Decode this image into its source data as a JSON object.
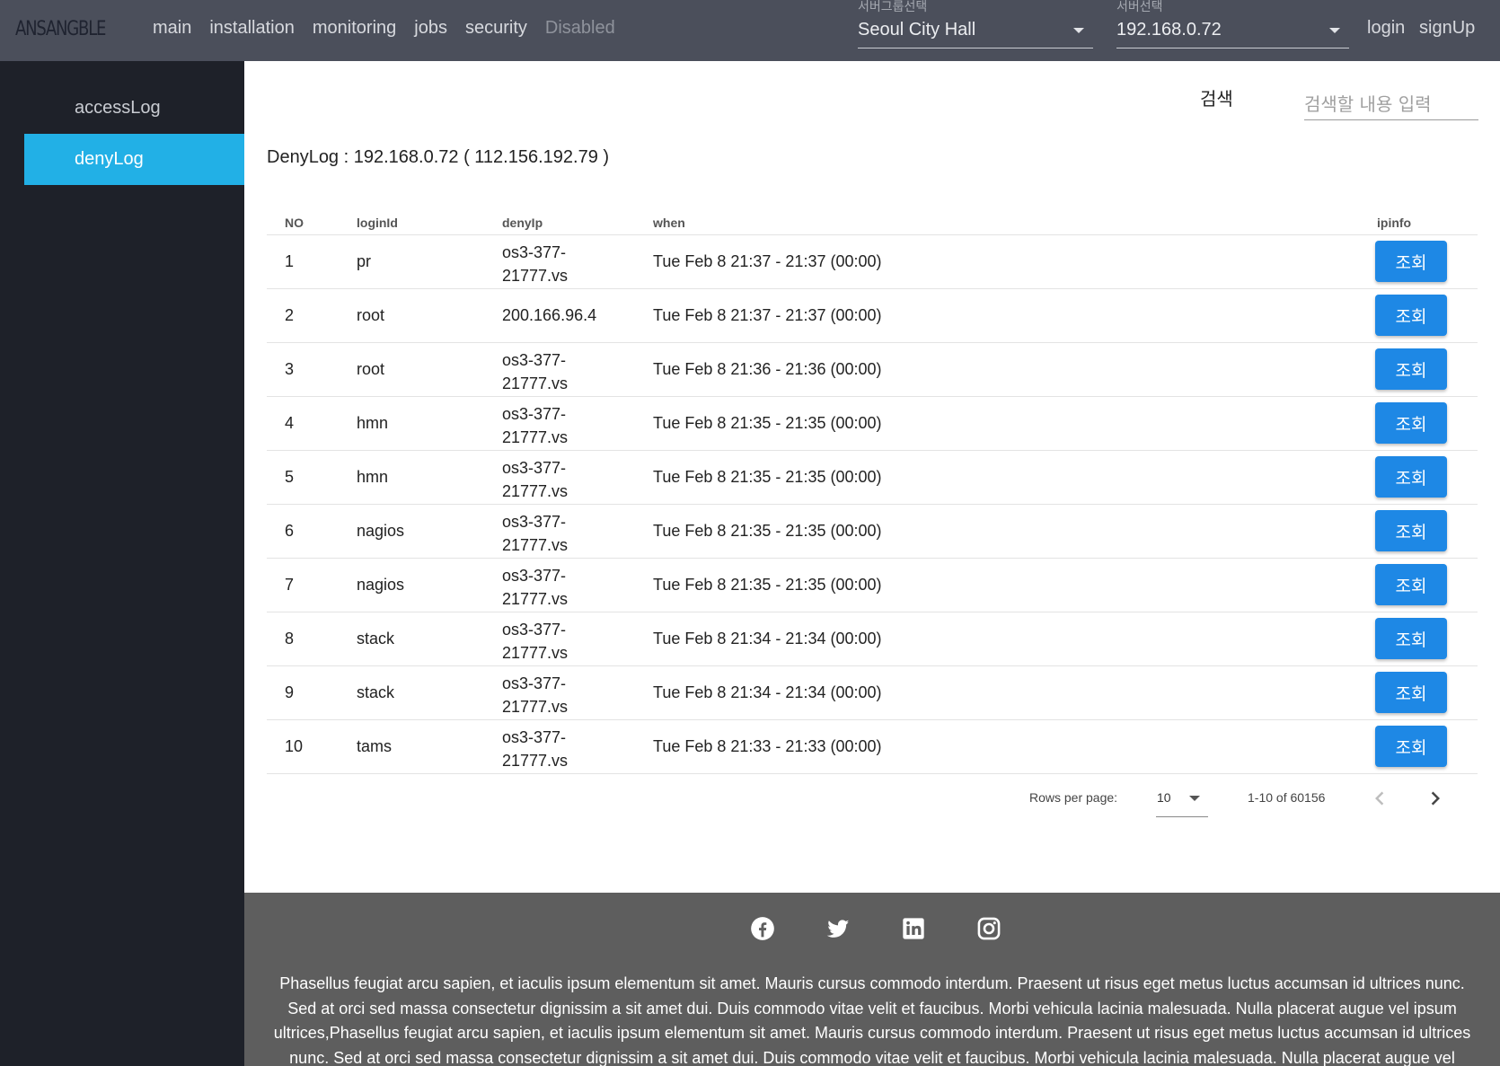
{
  "header": {
    "logo": "ANSANGBLE",
    "nav": [
      "main",
      "installation",
      "monitoring",
      "jobs",
      "security",
      "Disabled"
    ],
    "server_group": {
      "label": "서버그룹선택",
      "value": "Seoul City Hall"
    },
    "server": {
      "label": "서버선택",
      "value": "192.168.0.72"
    },
    "login": "login",
    "signup": "signUp"
  },
  "sidebar": {
    "items": [
      {
        "label": "accessLog"
      },
      {
        "label": "denyLog"
      }
    ]
  },
  "search": {
    "label": "검색",
    "placeholder": "검색할 내용 입력"
  },
  "table": {
    "title": "DenyLog : 192.168.0.72 ( 112.156.192.79 )",
    "headers": [
      "NO",
      "loginId",
      "denyIp",
      "when",
      "ipinfo"
    ],
    "button_label": "조회",
    "rows": [
      {
        "no": "1",
        "login": "pr",
        "ip": "os3-377-21777.vs",
        "when": "Tue Feb 8 21:37 - 21:37 (00:00)"
      },
      {
        "no": "2",
        "login": "root",
        "ip": "200.166.96.4",
        "when": "Tue Feb 8 21:37 - 21:37 (00:00)"
      },
      {
        "no": "3",
        "login": "root",
        "ip": "os3-377-21777.vs",
        "when": "Tue Feb 8 21:36 - 21:36 (00:00)"
      },
      {
        "no": "4",
        "login": "hmn",
        "ip": "os3-377-21777.vs",
        "when": "Tue Feb 8 21:35 - 21:35 (00:00)"
      },
      {
        "no": "5",
        "login": "hmn",
        "ip": "os3-377-21777.vs",
        "when": "Tue Feb 8 21:35 - 21:35 (00:00)"
      },
      {
        "no": "6",
        "login": "nagios",
        "ip": "os3-377-21777.vs",
        "when": "Tue Feb 8 21:35 - 21:35 (00:00)"
      },
      {
        "no": "7",
        "login": "nagios",
        "ip": "os3-377-21777.vs",
        "when": "Tue Feb 8 21:35 - 21:35 (00:00)"
      },
      {
        "no": "8",
        "login": "stack",
        "ip": "os3-377-21777.vs",
        "when": "Tue Feb 8 21:34 - 21:34 (00:00)"
      },
      {
        "no": "9",
        "login": "stack",
        "ip": "os3-377-21777.vs",
        "when": "Tue Feb 8 21:34 - 21:34 (00:00)"
      },
      {
        "no": "10",
        "login": "tams",
        "ip": "os3-377-21777.vs",
        "when": "Tue Feb 8 21:33 - 21:33 (00:00)"
      }
    ]
  },
  "pagination": {
    "rows_per_page_label": "Rows per page:",
    "rows_per_page": "10",
    "range": "1-10 of 60156"
  },
  "footer": {
    "social_icons": [
      "facebook-icon",
      "twitter-icon",
      "linkedin-icon",
      "instagram-icon"
    ],
    "text": "Phasellus feugiat arcu sapien, et iaculis ipsum elementum sit amet. Mauris cursus commodo interdum. Praesent ut risus eget metus luctus accumsan id ultrices nunc. Sed at orci sed massa consectetur dignissim a sit amet dui. Duis commodo vitae velit et faucibus. Morbi vehicula lacinia malesuada. Nulla placerat augue vel ipsum ultrices,Phasellus feugiat arcu sapien, et iaculis ipsum elementum sit amet. Mauris cursus commodo interdum. Praesent ut risus eget metus luctus accumsan id ultrices nunc. Sed at orci sed massa consectetur dignissim a sit amet dui. Duis commodo vitae velit et faucibus. Morbi vehicula lacinia malesuada. Nulla placerat augue vel ipsum"
  },
  "colors": {
    "topbar": "#4b4f5b",
    "sidebar": "#1e2129",
    "active": "#22b0e6",
    "button": "#1e88e5",
    "footer": "#5e5e5e"
  }
}
